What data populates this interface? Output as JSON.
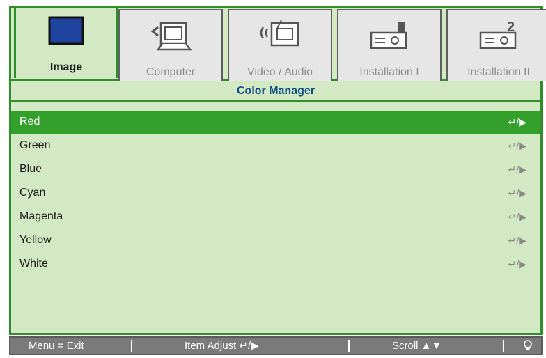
{
  "tabs": [
    {
      "label": "Image",
      "icon": "monitor-icon",
      "active": true
    },
    {
      "label": "Computer",
      "icon": "laptop-icon",
      "active": false
    },
    {
      "label": "Video / Audio",
      "icon": "tv-wireless-icon",
      "active": false
    },
    {
      "label": "Installation I",
      "icon": "projector-1-icon",
      "active": false
    },
    {
      "label": "Installation II",
      "icon": "projector-2-icon",
      "active": false
    }
  ],
  "section": {
    "title": "Color Manager"
  },
  "items": [
    {
      "label": "Red",
      "selected": true,
      "nav": "↵/▶"
    },
    {
      "label": "Green",
      "selected": false,
      "nav": "↵/▶"
    },
    {
      "label": "Blue",
      "selected": false,
      "nav": "↵/▶"
    },
    {
      "label": "Cyan",
      "selected": false,
      "nav": "↵/▶"
    },
    {
      "label": "Magenta",
      "selected": false,
      "nav": "↵/▶"
    },
    {
      "label": "Yellow",
      "selected": false,
      "nav": "↵/▶"
    },
    {
      "label": "White",
      "selected": false,
      "nav": "↵/▶"
    }
  ],
  "footer": {
    "menu": "Menu = Exit",
    "item_adjust": "Item Adjust ↵/▶",
    "scroll": "Scroll ▲▼",
    "icon": "lightbulb-icon"
  },
  "colors": {
    "accent_green": "#2f8f2a",
    "panel_bg": "#d3e9c3",
    "selection": "#33a02c",
    "title_blue": "#0e4f8a"
  }
}
